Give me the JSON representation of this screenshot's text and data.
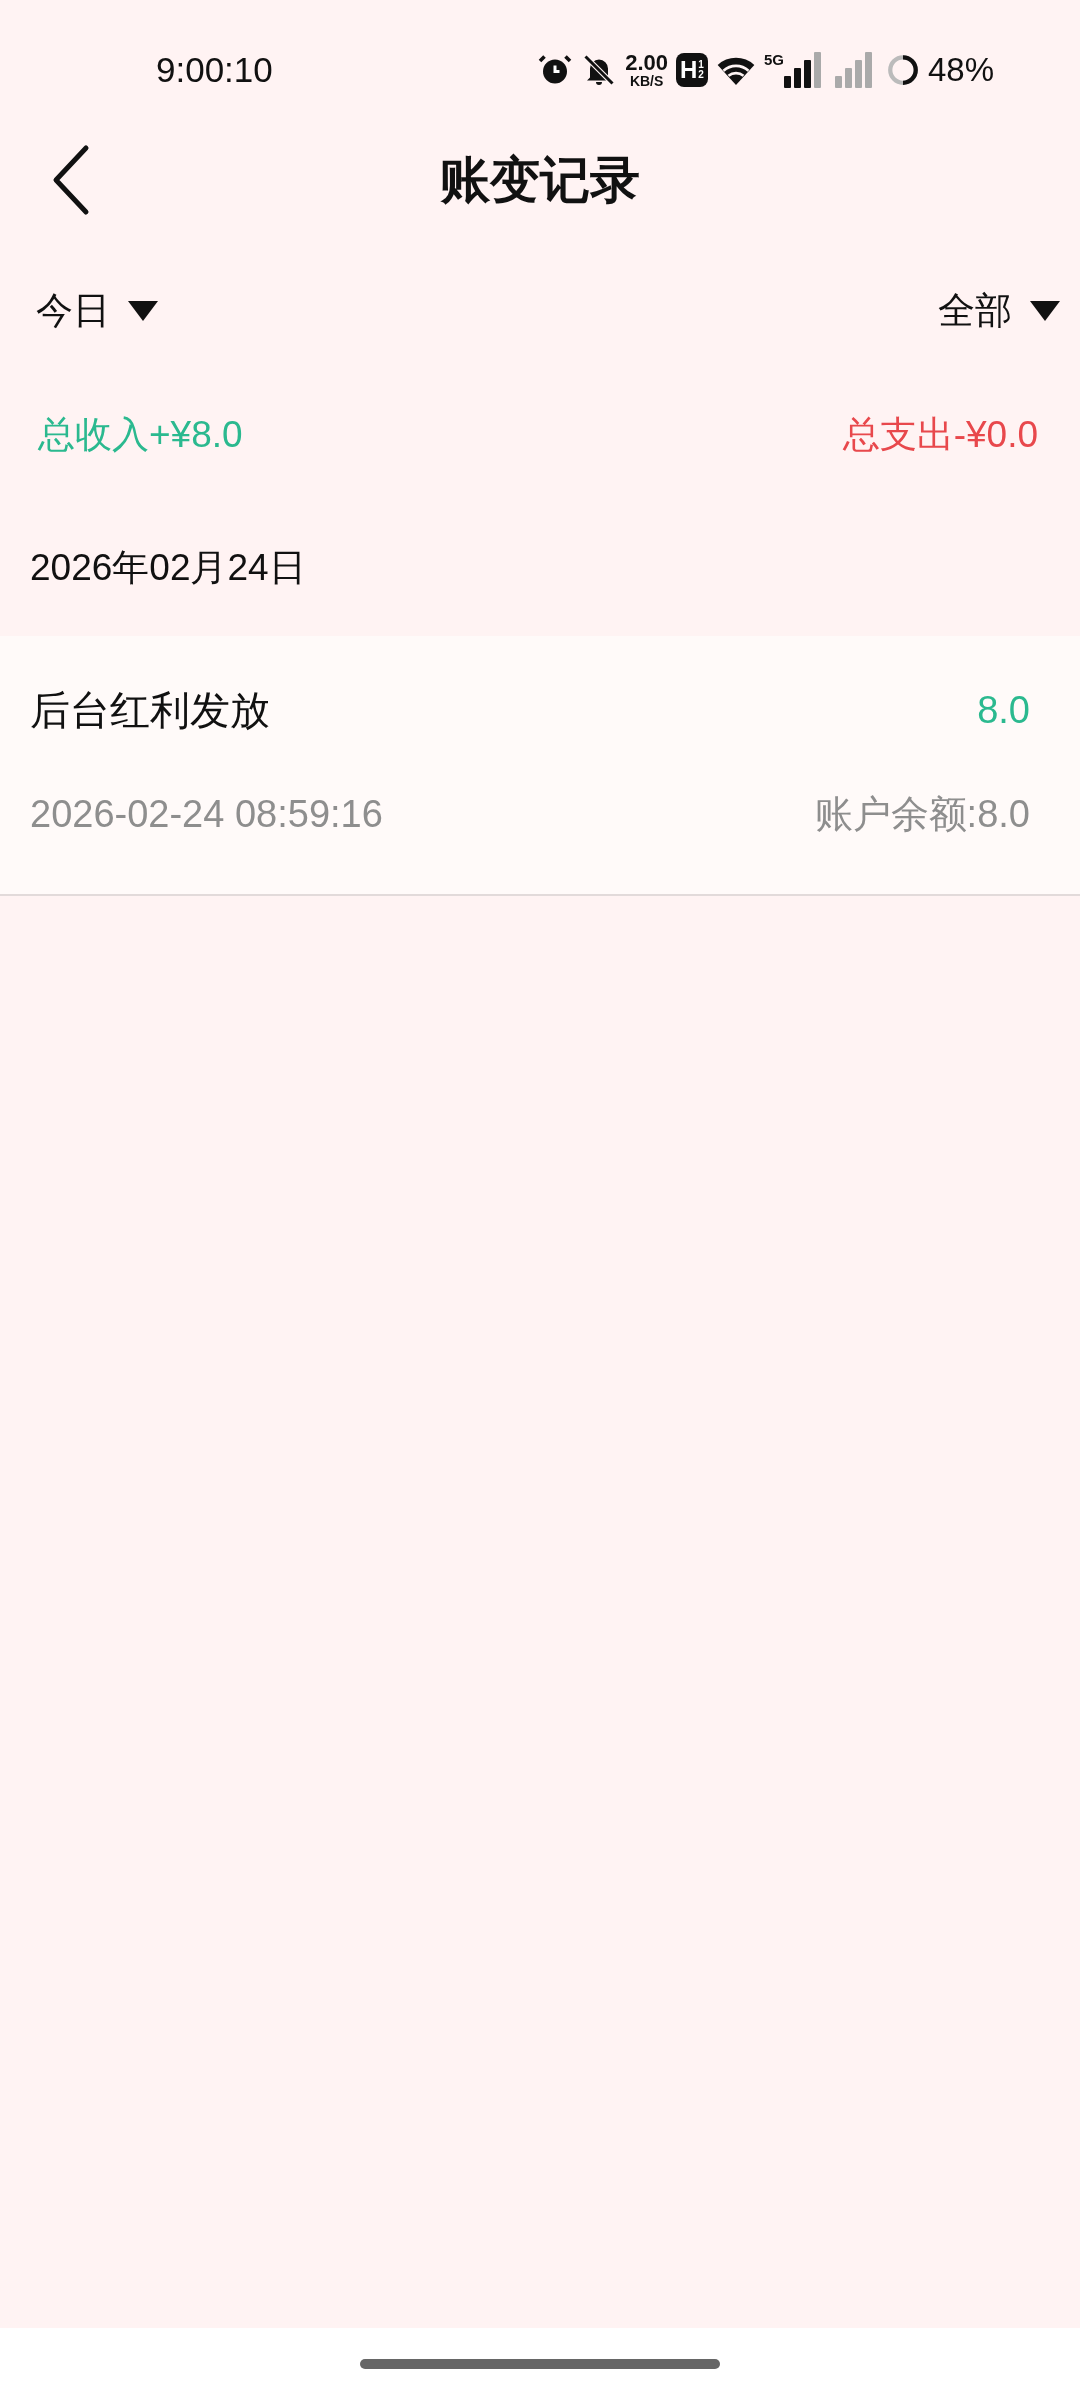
{
  "status_bar": {
    "time": "9:00:10",
    "speed_value": "2.00",
    "speed_unit": "KB/S",
    "hd_label": "H",
    "hd_sup": "1",
    "hd_sub": "2",
    "network": "5G",
    "battery": "48%"
  },
  "header": {
    "title": "账变记录"
  },
  "filters": [
    {
      "label": "今日"
    },
    {
      "label": "全部"
    }
  ],
  "totals": {
    "income": "总收入+¥8.0",
    "expense": "总支出-¥0.0"
  },
  "groups": [
    {
      "date": "2026年02月24日",
      "records": [
        {
          "title": "后台红利发放",
          "amount": "8.0",
          "kind": "income",
          "time": "2026-02-24 08:59:16",
          "balance": "账户余额:8.0"
        }
      ]
    }
  ]
}
